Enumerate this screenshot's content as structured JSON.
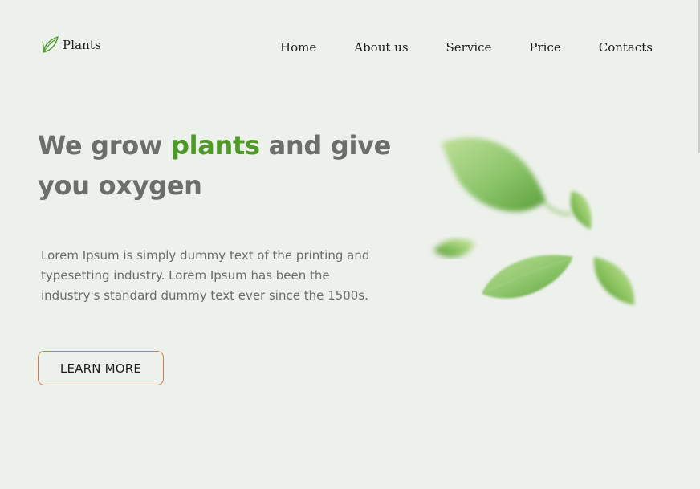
{
  "brand": {
    "name": "Plants",
    "icon": "leaf-icon",
    "accent_color": "#4d9a27"
  },
  "nav": {
    "items": [
      {
        "label": "Home"
      },
      {
        "label": "About us"
      },
      {
        "label": "Service"
      },
      {
        "label": "Price"
      },
      {
        "label": "Contacts"
      }
    ]
  },
  "hero": {
    "title_before": "We grow ",
    "title_accent": "plants",
    "title_after": " and give you oxygen",
    "description": "Lorem Ipsum is simply dummy text of the printing and typesetting industry. Lorem Ipsum has been the industry's standard dummy text ever since the 1500s.",
    "cta_label": "LEARN MORE",
    "cta_border_color": "#d9794f",
    "illustration": "blurred-leaves"
  },
  "colors": {
    "background": "#edf1ec",
    "heading": "#6c6e6c",
    "text": "#6a6c69"
  }
}
